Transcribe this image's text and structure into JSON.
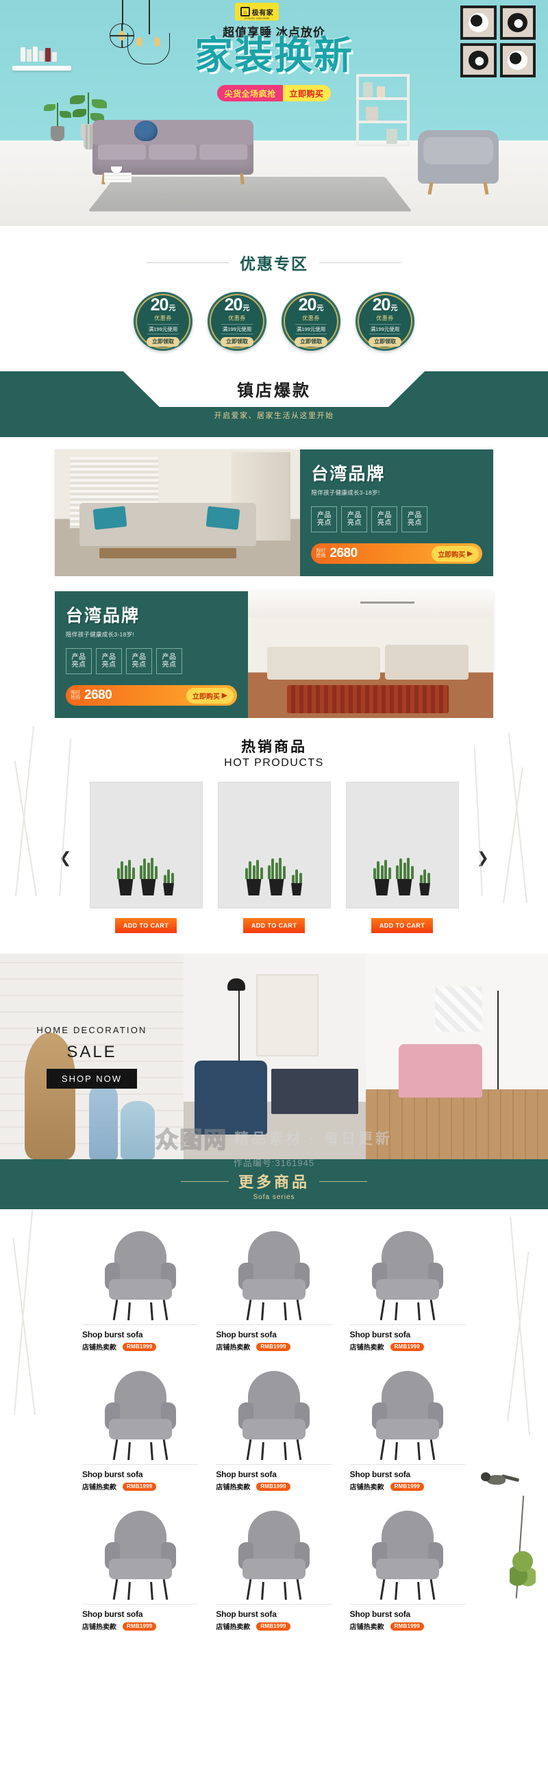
{
  "hero": {
    "logo": {
      "mark": "U",
      "name": "极有家",
      "sub": "JIYOUJIA · IDEA HOME"
    },
    "subtitle": "超值享睡 冰点放价",
    "title": "家装换新",
    "cta_left": "尖货全场疯抢",
    "cta_right": "立即购买"
  },
  "coupon_section": {
    "title": "优惠专区",
    "coupons": [
      {
        "amount": "20",
        "unit": "元",
        "kind": "优惠券",
        "condition": "满199元使用",
        "button": "立即领取"
      },
      {
        "amount": "20",
        "unit": "元",
        "kind": "优惠券",
        "condition": "满199元使用",
        "button": "立即领取"
      },
      {
        "amount": "20",
        "unit": "元",
        "kind": "优惠券",
        "condition": "满199元使用",
        "button": "立即领取"
      },
      {
        "amount": "20",
        "unit": "元",
        "kind": "优惠券",
        "condition": "满199元使用",
        "button": "立即领取"
      }
    ]
  },
  "hot_banner_header": {
    "title": "镇店爆款",
    "subtitle": "开启爱家、居家生活从这里开始"
  },
  "brand_banners": [
    {
      "title": "台湾品牌",
      "subtitle": "陪伴孩子健康成长3-18岁!",
      "points": [
        "产品\n亮点",
        "产品\n亮点",
        "产品\n亮点",
        "产品\n亮点"
      ],
      "point_line1": "产品",
      "point_line2": "亮点",
      "limit_line1": "限时",
      "limit_line2": "抢购",
      "currency": "¥",
      "price": "2680",
      "buy_button": "立即购买",
      "buy_arrow": "▶"
    },
    {
      "title": "台湾品牌",
      "subtitle": "陪伴孩子健康成长3-18岁!",
      "point_line1": "产品",
      "point_line2": "亮点",
      "limit_line1": "限时",
      "limit_line2": "抢购",
      "currency": "¥",
      "price": "2680",
      "buy_button": "立即购买",
      "buy_arrow": "▶"
    }
  ],
  "hot_products": {
    "title": "热销商品",
    "title_en": "HOT PRODUCTS",
    "prev_arrow": "❮",
    "next_arrow": "❯",
    "cards": [
      {
        "cta": "ADD TO CART"
      },
      {
        "cta": "ADD TO CART"
      },
      {
        "cta": "ADD TO CART"
      }
    ]
  },
  "lifestyle_strip": {
    "promo": {
      "line1": "HOME DECORATION",
      "line2": "SALE",
      "button": "SHOP NOW"
    }
  },
  "more_products": {
    "title": "更多商品",
    "subtitle": "Sofa series",
    "items": [
      {
        "name": "Shop burst sofa",
        "sub": "店铺热卖款",
        "price": "RMB1999"
      },
      {
        "name": "Shop burst sofa",
        "sub": "店铺热卖款",
        "price": "RMB1999"
      },
      {
        "name": "Shop burst sofa",
        "sub": "店铺热卖款",
        "price": "RMB1999"
      },
      {
        "name": "Shop burst sofa",
        "sub": "店铺热卖款",
        "price": "RMB1999"
      },
      {
        "name": "Shop burst sofa",
        "sub": "店铺热卖款",
        "price": "RMB1999"
      },
      {
        "name": "Shop burst sofa",
        "sub": "店铺热卖款",
        "price": "RMB1999"
      },
      {
        "name": "Shop burst sofa",
        "sub": "店铺热卖款",
        "price": "RMB1999"
      },
      {
        "name": "Shop burst sofa",
        "sub": "店铺热卖款",
        "price": "RMB1999"
      },
      {
        "name": "Shop burst sofa",
        "sub": "店铺热卖款",
        "price": "RMB1999"
      }
    ]
  },
  "watermark": {
    "logo": "众图网",
    "slogan": "精品素材 · 每日更新",
    "code": "作品编号:3161945"
  },
  "colors": {
    "hero_wall": "#93dcdf",
    "hero_title": "#1ba3a8",
    "brand_green": "#27615a",
    "coupon_green": "#1f5b52",
    "coupon_gold": "#e9d59a",
    "orange": "#f4590f",
    "cta_pink": "#f0397a",
    "cta_yellow": "#ffe84a"
  }
}
